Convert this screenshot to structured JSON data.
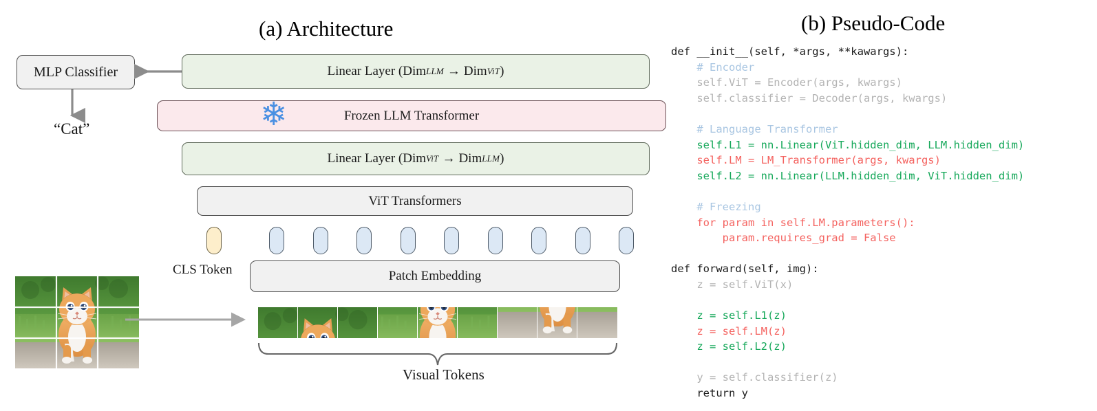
{
  "panels": {
    "architecture_title": "(a) Architecture",
    "pseudocode_title": "(b) Pseudo-Code"
  },
  "architecture": {
    "mlp_classifier": "MLP Classifier",
    "output_label": "“Cat”",
    "linear_top": {
      "prefix": "Linear Layer (Dim",
      "sub_from": "LLM",
      "arrow": "→",
      "mid": "Dim",
      "sub_to": "ViT",
      "suffix": ")"
    },
    "frozen_llm": "Frozen LLM Transformer",
    "snowflake_icon": "❄",
    "linear_bottom": {
      "prefix": "Linear Layer (Dim",
      "sub_from": "ViT",
      "arrow": "→",
      "mid": "Dim",
      "sub_to": "LLM",
      "suffix": ")"
    },
    "vit_transformers": "ViT Transformers",
    "patch_embedding": "Patch Embedding",
    "cls_token_label": "CLS Token",
    "visual_tokens_label": "Visual Tokens",
    "token_count_blue": 9,
    "token_count_cls": 1,
    "patch_count": 9,
    "source_image_grid": "3x3"
  },
  "colors": {
    "green_box_fill": "#eaf2e6",
    "pink_box_fill": "#fbe9ec",
    "gray_box_fill": "#f1f1f1",
    "cls_token_fill": "#fdeecb",
    "patch_token_fill": "#dce8f5",
    "snowflake": "#4a90e2",
    "arrow": "#8c8c8c",
    "code_comment": "#a9c6e2",
    "code_dim": "#b3b3b3",
    "code_green": "#16a85a",
    "code_red": "#f4625f",
    "code_key": "#1a1a1a"
  },
  "code": {
    "lines": [
      {
        "id": "l1",
        "indent": 0,
        "segments": [
          {
            "t": "def __init__(self, *args, **kawargs):",
            "c": "key"
          }
        ]
      },
      {
        "id": "l2",
        "indent": 1,
        "segments": [
          {
            "t": "# Encoder",
            "c": "cmt"
          }
        ]
      },
      {
        "id": "l3",
        "indent": 1,
        "segments": [
          {
            "t": "self.ViT = Encoder(args, kwargs)",
            "c": "dim"
          }
        ]
      },
      {
        "id": "l4",
        "indent": 1,
        "segments": [
          {
            "t": "self.classifier = Decoder(args, kwargs)",
            "c": "dim"
          }
        ]
      },
      {
        "id": "l5",
        "indent": 0,
        "segments": []
      },
      {
        "id": "l6",
        "indent": 1,
        "segments": [
          {
            "t": "# Language Transformer",
            "c": "cmt"
          }
        ]
      },
      {
        "id": "l7",
        "indent": 1,
        "segments": [
          {
            "t": "self.L1 = nn.Linear(ViT.hidden_dim, LLM.hidden_dim)",
            "c": "grn"
          }
        ]
      },
      {
        "id": "l8",
        "indent": 1,
        "segments": [
          {
            "t": "self.LM = LM_Transformer(args, kwargs)",
            "c": "red"
          }
        ]
      },
      {
        "id": "l9",
        "indent": 1,
        "segments": [
          {
            "t": "self.L2 = nn.Linear(LLM.hidden_dim, ViT.hidden_dim)",
            "c": "grn"
          }
        ]
      },
      {
        "id": "l10",
        "indent": 0,
        "segments": []
      },
      {
        "id": "l11",
        "indent": 1,
        "segments": [
          {
            "t": "# Freezing",
            "c": "cmt"
          }
        ]
      },
      {
        "id": "l12",
        "indent": 1,
        "segments": [
          {
            "t": "for param in self.LM.parameters():",
            "c": "red"
          }
        ]
      },
      {
        "id": "l13",
        "indent": 2,
        "segments": [
          {
            "t": "param.requires_grad = False",
            "c": "red"
          }
        ]
      },
      {
        "id": "l14",
        "indent": 0,
        "segments": []
      },
      {
        "id": "l15",
        "indent": 0,
        "segments": [
          {
            "t": "def forward(self, img):",
            "c": "key"
          }
        ]
      },
      {
        "id": "l16",
        "indent": 1,
        "segments": [
          {
            "t": "z = self.ViT(x)",
            "c": "dim"
          }
        ]
      },
      {
        "id": "l17",
        "indent": 0,
        "segments": []
      },
      {
        "id": "l18",
        "indent": 1,
        "segments": [
          {
            "t": "z = self.L1(z)",
            "c": "grn"
          }
        ]
      },
      {
        "id": "l19",
        "indent": 1,
        "segments": [
          {
            "t": "z = self.LM(z)",
            "c": "red"
          }
        ]
      },
      {
        "id": "l20",
        "indent": 1,
        "segments": [
          {
            "t": "z = self.L2(z)",
            "c": "grn"
          }
        ]
      },
      {
        "id": "l21",
        "indent": 0,
        "segments": []
      },
      {
        "id": "l22",
        "indent": 1,
        "segments": [
          {
            "t": "y = self.classifier(z)",
            "c": "dim"
          }
        ]
      },
      {
        "id": "l23",
        "indent": 1,
        "segments": [
          {
            "t": "return y",
            "c": "key"
          }
        ]
      }
    ]
  }
}
